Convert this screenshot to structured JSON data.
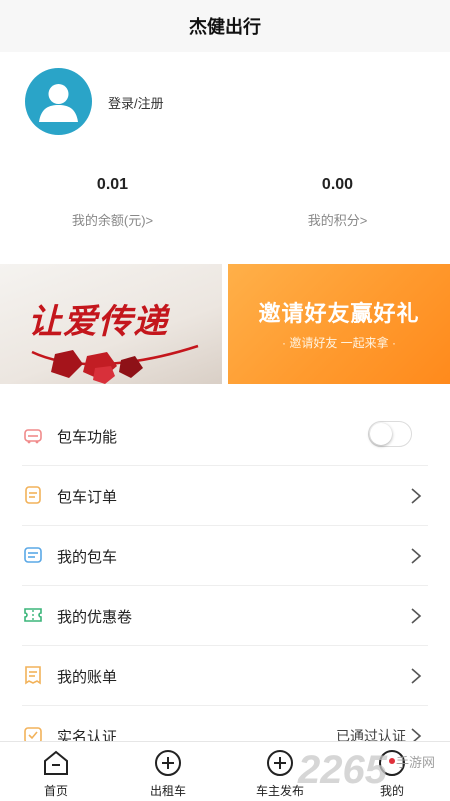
{
  "header": {
    "title": "杰健出行"
  },
  "profile": {
    "login_label": "登录/注册"
  },
  "stats": {
    "balance": {
      "value": "0.01",
      "label": "我的余额(元)>"
    },
    "points": {
      "value": "0.00",
      "label": "我的积分>"
    }
  },
  "banners": {
    "left": {
      "text": "让爱传递"
    },
    "right": {
      "title": "邀请好友赢好礼",
      "subtitle": "· 邀请好友 一起来拿 ·"
    }
  },
  "menu": [
    {
      "label": "包车功能",
      "icon": "car-icon",
      "icon_color": "#f08a8a",
      "control": "toggle",
      "toggle_on": false
    },
    {
      "label": "包车订单",
      "icon": "order-icon",
      "icon_color": "#f2b25a",
      "control": "chevron"
    },
    {
      "label": "我的包车",
      "icon": "list-icon",
      "icon_color": "#5aa8e6",
      "control": "chevron"
    },
    {
      "label": "我的优惠卷",
      "icon": "coupon-icon",
      "icon_color": "#3bb57a",
      "control": "chevron"
    },
    {
      "label": "我的账单",
      "icon": "bill-icon",
      "icon_color": "#f2b25a",
      "control": "chevron"
    },
    {
      "label": "实名认证",
      "icon": "verify-icon",
      "icon_color": "#f2b25a",
      "control": "status",
      "status": "已通过认证"
    }
  ],
  "tabbar": [
    {
      "label": "首页",
      "icon": "home-icon"
    },
    {
      "label": "出租车",
      "icon": "plus-circle-icon"
    },
    {
      "label": "车主发布",
      "icon": "plus-circle-icon"
    },
    {
      "label": "我的",
      "icon": "user-icon"
    }
  ],
  "watermark": {
    "digits": "2265",
    "text": "手游网"
  },
  "colors": {
    "avatar": "#2aa4c8",
    "header_bg": "#f7f7f7",
    "invite_banner": "#ff9a2e",
    "love_text": "#c4161c"
  }
}
